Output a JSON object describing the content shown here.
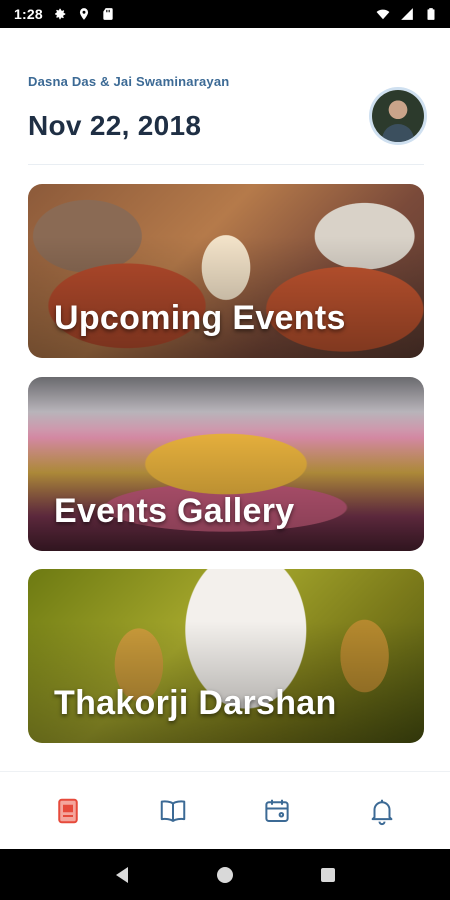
{
  "status_bar": {
    "time": "1:28",
    "left_icons": [
      "gear-icon",
      "location-pin-icon",
      "sd-card-icon"
    ],
    "right_icons": [
      "wifi-icon",
      "signal-icon",
      "battery-icon"
    ]
  },
  "header": {
    "greeting": "Dasna Das & Jai Swaminarayan",
    "date": "Nov 22, 2018"
  },
  "cards": [
    {
      "title": "Upcoming Events"
    },
    {
      "title": "Events Gallery"
    },
    {
      "title": "Thakorji Darshan"
    }
  ],
  "bottom_nav": {
    "items": [
      {
        "icon": "document-icon",
        "active": true
      },
      {
        "icon": "book-icon",
        "active": false
      },
      {
        "icon": "calendar-icon",
        "active": false
      },
      {
        "icon": "bell-icon",
        "active": false
      }
    ],
    "colors": {
      "active": "#e64a3b",
      "inactive": "#3c6a95"
    }
  },
  "system_nav": [
    "back-icon",
    "home-icon",
    "recents-icon"
  ]
}
